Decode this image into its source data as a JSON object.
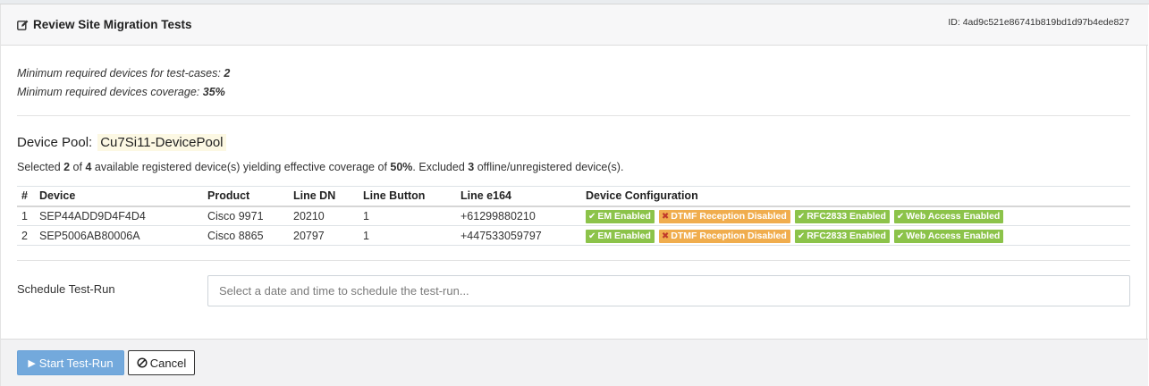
{
  "header": {
    "title": "Review Site Migration Tests",
    "id_text": "ID: 4ad9c521e86741b819bd1d97b4ede827"
  },
  "minimums": {
    "testcases_label": "Minimum required devices for test-cases:",
    "testcases_value": "2",
    "coverage_label": "Minimum required devices coverage:",
    "coverage_value": "35%"
  },
  "pool": {
    "label": "Device Pool:",
    "name": "Cu7Si11-DevicePool"
  },
  "summary": {
    "t1": "Selected ",
    "selected": "2",
    "t2": " of ",
    "available": "4",
    "t3": " available registered device(s) yielding effective coverage of ",
    "coverage": "50%",
    "t4": ". Excluded ",
    "excluded": "3",
    "t5": " offline/unregistered device(s)."
  },
  "table": {
    "headers": [
      "#",
      "Device",
      "Product",
      "Line DN",
      "Line Button",
      "Line e164",
      "Device Configuration"
    ],
    "rows": [
      {
        "num": "1",
        "device": "SEP44ADD9D4F4D4",
        "product": "Cisco 9971",
        "line_dn": "20210",
        "line_button": "1",
        "line_e164": "+61299880210",
        "badges": [
          {
            "icon": "check-icon",
            "label": "EM Enabled",
            "status": "ok"
          },
          {
            "icon": "x-icon",
            "label": "DTMF Reception Disabled",
            "status": "warn"
          },
          {
            "icon": "check-icon",
            "label": "RFC2833 Enabled",
            "status": "ok"
          },
          {
            "icon": "check-icon",
            "label": "Web Access Enabled",
            "status": "ok"
          }
        ]
      },
      {
        "num": "2",
        "device": "SEP5006AB80006A",
        "product": "Cisco 8865",
        "line_dn": "20797",
        "line_button": "1",
        "line_e164": "+447533059797",
        "badges": [
          {
            "icon": "check-icon",
            "label": "EM Enabled",
            "status": "ok"
          },
          {
            "icon": "x-icon",
            "label": "DTMF Reception Disabled",
            "status": "warn"
          },
          {
            "icon": "check-icon",
            "label": "RFC2833 Enabled",
            "status": "ok"
          },
          {
            "icon": "check-icon",
            "label": "Web Access Enabled",
            "status": "ok"
          }
        ]
      }
    ]
  },
  "schedule": {
    "label": "Schedule Test-Run",
    "placeholder": "Select a date and time to schedule the test-run..."
  },
  "footer": {
    "start_label": "Start Test-Run",
    "cancel_label": "Cancel"
  },
  "colors": {
    "ok": "#8cc34a",
    "warn": "#f0ad4e",
    "primary": "#73a9dc",
    "highlight": "#fcf8e3"
  }
}
